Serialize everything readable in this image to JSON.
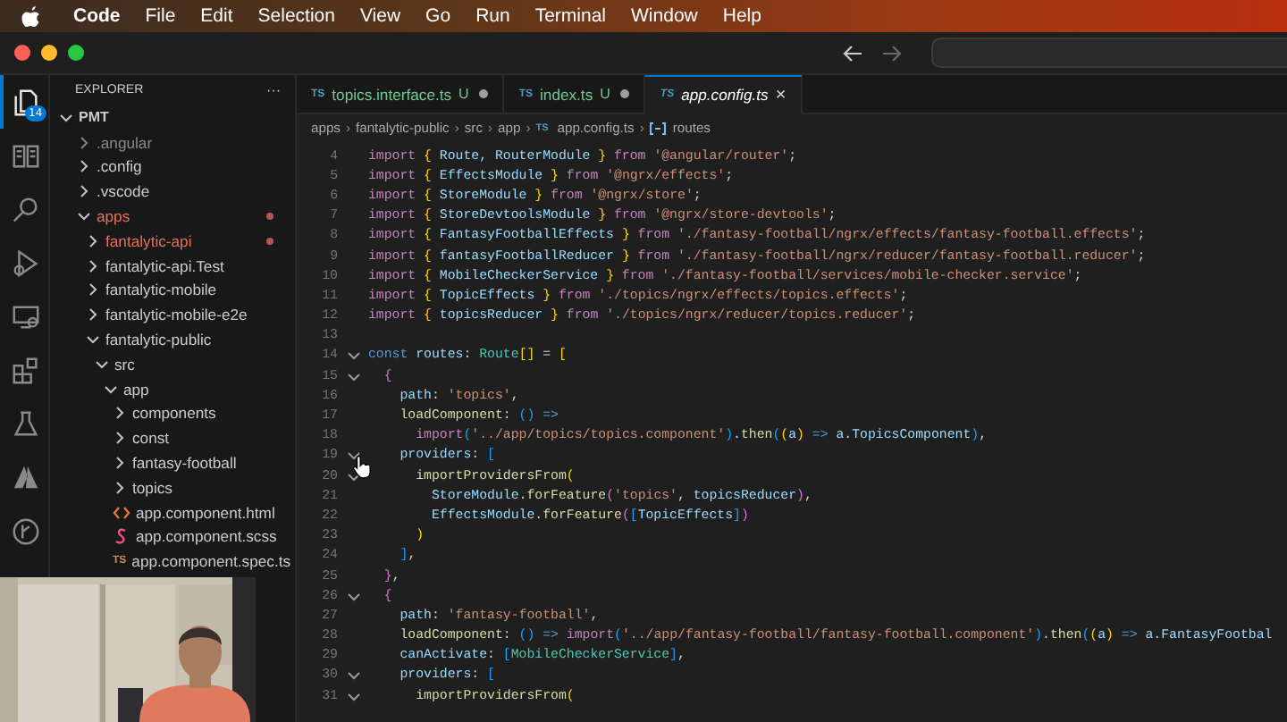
{
  "menubar": {
    "app": "Code",
    "items": [
      "File",
      "Edit",
      "Selection",
      "View",
      "Go",
      "Run",
      "Terminal",
      "Window",
      "Help"
    ]
  },
  "activity_bar": [
    {
      "kind": "files",
      "selected": true,
      "badge": "14"
    },
    {
      "kind": "book",
      "selected": false
    },
    {
      "kind": "search",
      "selected": false
    },
    {
      "kind": "debug",
      "selected": false
    },
    {
      "kind": "remote",
      "selected": false
    },
    {
      "kind": "extensions",
      "selected": false
    },
    {
      "kind": "flask",
      "selected": false
    },
    {
      "kind": "triangle",
      "selected": false
    },
    {
      "kind": "branch",
      "selected": false
    }
  ],
  "sidebar": {
    "title": "EXPLORER",
    "more": "···",
    "root": {
      "name": "PMT",
      "expanded": true,
      "children": [
        {
          "name": ".angular",
          "kind": "folder",
          "expanded": false,
          "modified": false,
          "ignored": true
        },
        {
          "name": ".config",
          "kind": "folder",
          "expanded": false,
          "modified": false,
          "ignored": false
        },
        {
          "name": ".vscode",
          "kind": "folder",
          "expanded": false,
          "modified": false,
          "ignored": false
        },
        {
          "name": "apps",
          "kind": "folder",
          "expanded": true,
          "modified": true,
          "ignored": false,
          "children": [
            {
              "name": "fantalytic-api",
              "kind": "folder",
              "expanded": false,
              "modified": true,
              "ignored": false
            },
            {
              "name": "fantalytic-api.Test",
              "kind": "folder",
              "expanded": false,
              "modified": false,
              "ignored": false
            },
            {
              "name": "fantalytic-mobile",
              "kind": "folder",
              "expanded": false,
              "modified": false,
              "ignored": false
            },
            {
              "name": "fantalytic-mobile-e2e",
              "kind": "folder",
              "expanded": false,
              "modified": false,
              "ignored": false
            },
            {
              "name": "fantalytic-public",
              "kind": "folder",
              "expanded": true,
              "modified": false,
              "ignored": false,
              "children": [
                {
                  "name": "src",
                  "kind": "folder",
                  "expanded": true,
                  "modified": false,
                  "ignored": false,
                  "children": [
                    {
                      "name": "app",
                      "kind": "folder",
                      "expanded": true,
                      "modified": false,
                      "ignored": false,
                      "children": [
                        {
                          "name": "components",
                          "kind": "folder",
                          "expanded": false,
                          "modified": false,
                          "ignored": false
                        },
                        {
                          "name": "const",
                          "kind": "folder",
                          "expanded": false,
                          "modified": false,
                          "ignored": false
                        },
                        {
                          "name": "fantasy-football",
                          "kind": "folder",
                          "expanded": false,
                          "modified": false,
                          "ignored": false
                        },
                        {
                          "name": "topics",
                          "kind": "folder",
                          "expanded": false,
                          "modified": false,
                          "ignored": false
                        },
                        {
                          "name": "app.component.html",
                          "kind": "html",
                          "modified": false,
                          "ignored": false
                        },
                        {
                          "name": "app.component.scss",
                          "kind": "scss",
                          "modified": false,
                          "ignored": false
                        },
                        {
                          "name": "app.component.spec.ts",
                          "kind": "ts",
                          "icon_label": "TS",
                          "modified": false,
                          "ignored": false
                        }
                      ]
                    }
                  ]
                }
              ]
            }
          ]
        }
      ]
    }
  },
  "editor": {
    "tabs": [
      {
        "icon_label": "TS",
        "label": "topics.interface.ts",
        "status": "U",
        "selected": false
      },
      {
        "icon_label": "TS",
        "label": "index.ts",
        "status": "U",
        "selected": false
      },
      {
        "icon_label": "TS",
        "label": "app.config.ts",
        "selected": true,
        "close": "×"
      }
    ],
    "breadcrumb": [
      {
        "label": "apps"
      },
      {
        "label": "fantalytic-public"
      },
      {
        "label": "src"
      },
      {
        "label": "app"
      },
      {
        "label": "app.config.ts",
        "icon_label": "TS"
      },
      {
        "label": "routes",
        "kind": "symbol"
      }
    ],
    "breadcrumb_separator": "›",
    "lines": [
      {
        "number": "4",
        "fold": false,
        "tokens": [
          {
            "kind": "kw",
            "text": "import "
          },
          {
            "kind": "b1",
            "text": "{"
          },
          {
            "kind": "id",
            "text": " Route, RouterModule "
          },
          {
            "kind": "b1",
            "text": "}"
          },
          {
            "kind": "kw",
            "text": " from "
          },
          {
            "kind": "str",
            "text": "'@angular/router'"
          },
          {
            "kind": "p",
            "text": ";"
          }
        ]
      },
      {
        "number": "5",
        "fold": false,
        "tokens": [
          {
            "kind": "kw",
            "text": "import "
          },
          {
            "kind": "b1",
            "text": "{"
          },
          {
            "kind": "id",
            "text": " EffectsModule "
          },
          {
            "kind": "b1",
            "text": "}"
          },
          {
            "kind": "kw",
            "text": " from "
          },
          {
            "kind": "str",
            "text": "'@ngrx/effects'"
          },
          {
            "kind": "p",
            "text": ";"
          }
        ]
      },
      {
        "number": "6",
        "fold": false,
        "tokens": [
          {
            "kind": "kw",
            "text": "import "
          },
          {
            "kind": "b1",
            "text": "{"
          },
          {
            "kind": "id",
            "text": " StoreModule "
          },
          {
            "kind": "b1",
            "text": "}"
          },
          {
            "kind": "kw",
            "text": " from "
          },
          {
            "kind": "str",
            "text": "'@ngrx/store'"
          },
          {
            "kind": "p",
            "text": ";"
          }
        ]
      },
      {
        "number": "7",
        "fold": false,
        "tokens": [
          {
            "kind": "kw",
            "text": "import "
          },
          {
            "kind": "b1",
            "text": "{"
          },
          {
            "kind": "id",
            "text": " StoreDevtoolsModule "
          },
          {
            "kind": "b1",
            "text": "}"
          },
          {
            "kind": "kw",
            "text": " from "
          },
          {
            "kind": "str",
            "text": "'@ngrx/store-devtools'"
          },
          {
            "kind": "p",
            "text": ";"
          }
        ]
      },
      {
        "number": "8",
        "fold": false,
        "tokens": [
          {
            "kind": "kw",
            "text": "import "
          },
          {
            "kind": "b1",
            "text": "{"
          },
          {
            "kind": "id",
            "text": " FantasyFootballEffects "
          },
          {
            "kind": "b1",
            "text": "}"
          },
          {
            "kind": "kw",
            "text": " from "
          },
          {
            "kind": "str",
            "text": "'./fantasy-football/ngrx/effects/fantasy-football.effects'"
          },
          {
            "kind": "p",
            "text": ";"
          }
        ]
      },
      {
        "number": "9",
        "fold": false,
        "tokens": [
          {
            "kind": "kw",
            "text": "import "
          },
          {
            "kind": "b1",
            "text": "{"
          },
          {
            "kind": "id",
            "text": " fantasyFootballReducer "
          },
          {
            "kind": "b1",
            "text": "}"
          },
          {
            "kind": "kw",
            "text": " from "
          },
          {
            "kind": "str",
            "text": "'./fantasy-football/ngrx/reducer/fantasy-football.reducer'"
          },
          {
            "kind": "p",
            "text": ";"
          }
        ]
      },
      {
        "number": "10",
        "fold": false,
        "tokens": [
          {
            "kind": "kw",
            "text": "import "
          },
          {
            "kind": "b1",
            "text": "{"
          },
          {
            "kind": "id",
            "text": " MobileCheckerService "
          },
          {
            "kind": "b1",
            "text": "}"
          },
          {
            "kind": "kw",
            "text": " from "
          },
          {
            "kind": "str",
            "text": "'./fantasy-football/services/mobile-checker.service'"
          },
          {
            "kind": "p",
            "text": ";"
          }
        ]
      },
      {
        "number": "11",
        "fold": false,
        "tokens": [
          {
            "kind": "kw",
            "text": "import "
          },
          {
            "kind": "b1",
            "text": "{"
          },
          {
            "kind": "id",
            "text": " TopicEffects "
          },
          {
            "kind": "b1",
            "text": "}"
          },
          {
            "kind": "kw",
            "text": " from "
          },
          {
            "kind": "str",
            "text": "'./topics/ngrx/effects/topics.effects'"
          },
          {
            "kind": "p",
            "text": ";"
          }
        ]
      },
      {
        "number": "12",
        "fold": false,
        "tokens": [
          {
            "kind": "kw",
            "text": "import "
          },
          {
            "kind": "b1",
            "text": "{"
          },
          {
            "kind": "id",
            "text": " topicsReducer "
          },
          {
            "kind": "b1",
            "text": "}"
          },
          {
            "kind": "kw",
            "text": " from "
          },
          {
            "kind": "str",
            "text": "'./topics/ngrx/reducer/topics.reducer'"
          },
          {
            "kind": "p",
            "text": ";"
          }
        ]
      },
      {
        "number": "13",
        "fold": false
      },
      {
        "number": "14",
        "fold": true,
        "tokens": [
          {
            "kind": "decl",
            "text": "const "
          },
          {
            "kind": "id",
            "text": "routes"
          },
          {
            "kind": "p",
            "text": ": "
          },
          {
            "kind": "type",
            "text": "Route"
          },
          {
            "kind": "b1",
            "text": "[]"
          },
          {
            "kind": "p",
            "text": " = "
          },
          {
            "kind": "b1",
            "text": "["
          }
        ]
      },
      {
        "number": "15",
        "fold": true,
        "tokens": [
          {
            "kind": "b2",
            "text": "  {"
          }
        ]
      },
      {
        "number": "16",
        "fold": false,
        "tokens": [
          {
            "kind": "id",
            "text": "    path"
          },
          {
            "kind": "p",
            "text": ": "
          },
          {
            "kind": "str",
            "text": "'topics'"
          },
          {
            "kind": "p",
            "text": ","
          }
        ]
      },
      {
        "number": "17",
        "fold": false,
        "tokens": [
          {
            "kind": "fn",
            "text": "    loadComponent"
          },
          {
            "kind": "p",
            "text": ": "
          },
          {
            "kind": "b3",
            "text": "()"
          },
          {
            "kind": "decl",
            "text": " =>"
          }
        ]
      },
      {
        "number": "18",
        "fold": false,
        "tokens": [
          {
            "kind": "kw",
            "text": "      import"
          },
          {
            "kind": "b3",
            "text": "("
          },
          {
            "kind": "str",
            "text": "'../app/topics/topics.component'"
          },
          {
            "kind": "b3",
            "text": ")"
          },
          {
            "kind": "p",
            "text": "."
          },
          {
            "kind": "fn",
            "text": "then"
          },
          {
            "kind": "b3",
            "text": "("
          },
          {
            "kind": "b1",
            "text": "("
          },
          {
            "kind": "id",
            "text": "a"
          },
          {
            "kind": "b1",
            "text": ")"
          },
          {
            "kind": "decl",
            "text": " => "
          },
          {
            "kind": "id",
            "text": "a"
          },
          {
            "kind": "p",
            "text": "."
          },
          {
            "kind": "id",
            "text": "TopicsComponent"
          },
          {
            "kind": "b3",
            "text": ")"
          },
          {
            "kind": "p",
            "text": ","
          }
        ]
      },
      {
        "number": "19",
        "fold": true,
        "tokens": [
          {
            "kind": "id",
            "text": "    providers"
          },
          {
            "kind": "p",
            "text": ": "
          },
          {
            "kind": "b3",
            "text": "["
          }
        ]
      },
      {
        "number": "20",
        "fold": true,
        "tokens": [
          {
            "kind": "fn",
            "text": "      importProvidersFrom"
          },
          {
            "kind": "b1",
            "text": "("
          }
        ]
      },
      {
        "number": "21",
        "fold": false,
        "tokens": [
          {
            "kind": "id",
            "text": "        StoreModule"
          },
          {
            "kind": "p",
            "text": "."
          },
          {
            "kind": "fn",
            "text": "forFeature"
          },
          {
            "kind": "b2",
            "text": "("
          },
          {
            "kind": "str",
            "text": "'topics'"
          },
          {
            "kind": "p",
            "text": ", "
          },
          {
            "kind": "id",
            "text": "topicsReducer"
          },
          {
            "kind": "b2",
            "text": ")"
          },
          {
            "kind": "p",
            "text": ","
          }
        ]
      },
      {
        "number": "22",
        "fold": false,
        "tokens": [
          {
            "kind": "id",
            "text": "        EffectsModule"
          },
          {
            "kind": "p",
            "text": "."
          },
          {
            "kind": "fn",
            "text": "forFeature"
          },
          {
            "kind": "b2",
            "text": "("
          },
          {
            "kind": "b3",
            "text": "["
          },
          {
            "kind": "id",
            "text": "TopicEffects"
          },
          {
            "kind": "b3",
            "text": "]"
          },
          {
            "kind": "b2",
            "text": ")"
          }
        ]
      },
      {
        "number": "23",
        "fold": false,
        "tokens": [
          {
            "kind": "b1",
            "text": "      )"
          }
        ]
      },
      {
        "number": "24",
        "fold": false,
        "tokens": [
          {
            "kind": "b3",
            "text": "    ]"
          },
          {
            "kind": "p",
            "text": ","
          }
        ]
      },
      {
        "number": "25",
        "fold": false,
        "tokens": [
          {
            "kind": "b2",
            "text": "  }"
          },
          {
            "kind": "p",
            "text": ","
          }
        ]
      },
      {
        "number": "26",
        "fold": true,
        "tokens": [
          {
            "kind": "b2",
            "text": "  {"
          }
        ]
      },
      {
        "number": "27",
        "fold": false,
        "tokens": [
          {
            "kind": "id",
            "text": "    path"
          },
          {
            "kind": "p",
            "text": ": "
          },
          {
            "kind": "str",
            "text": "'fantasy-football'"
          },
          {
            "kind": "p",
            "text": ","
          }
        ]
      },
      {
        "number": "28",
        "fold": false,
        "tokens": [
          {
            "kind": "fn",
            "text": "    loadComponent"
          },
          {
            "kind": "p",
            "text": ": "
          },
          {
            "kind": "b3",
            "text": "()"
          },
          {
            "kind": "decl",
            "text": " => "
          },
          {
            "kind": "kw",
            "text": "import"
          },
          {
            "kind": "b3",
            "text": "("
          },
          {
            "kind": "str",
            "text": "'../app/fantasy-football/fantasy-football.component'"
          },
          {
            "kind": "b3",
            "text": ")"
          },
          {
            "kind": "p",
            "text": "."
          },
          {
            "kind": "fn",
            "text": "then"
          },
          {
            "kind": "b3",
            "text": "("
          },
          {
            "kind": "b1",
            "text": "("
          },
          {
            "kind": "id",
            "text": "a"
          },
          {
            "kind": "b1",
            "text": ")"
          },
          {
            "kind": "decl",
            "text": " => "
          },
          {
            "kind": "id",
            "text": "a"
          },
          {
            "kind": "p",
            "text": "."
          },
          {
            "kind": "id",
            "text": "FantasyFootbal"
          }
        ]
      },
      {
        "number": "29",
        "fold": false,
        "tokens": [
          {
            "kind": "id",
            "text": "    canActivate"
          },
          {
            "kind": "p",
            "text": ": "
          },
          {
            "kind": "b3",
            "text": "["
          },
          {
            "kind": "type",
            "text": "MobileCheckerService"
          },
          {
            "kind": "b3",
            "text": "]"
          },
          {
            "kind": "p",
            "text": ","
          }
        ]
      },
      {
        "number": "30",
        "fold": true,
        "tokens": [
          {
            "kind": "id",
            "text": "    providers"
          },
          {
            "kind": "p",
            "text": ": "
          },
          {
            "kind": "b3",
            "text": "["
          }
        ]
      },
      {
        "number": "31",
        "fold": true,
        "tokens": [
          {
            "kind": "fn",
            "text": "      importProvidersFrom"
          },
          {
            "kind": "b1",
            "text": "("
          }
        ]
      }
    ]
  }
}
